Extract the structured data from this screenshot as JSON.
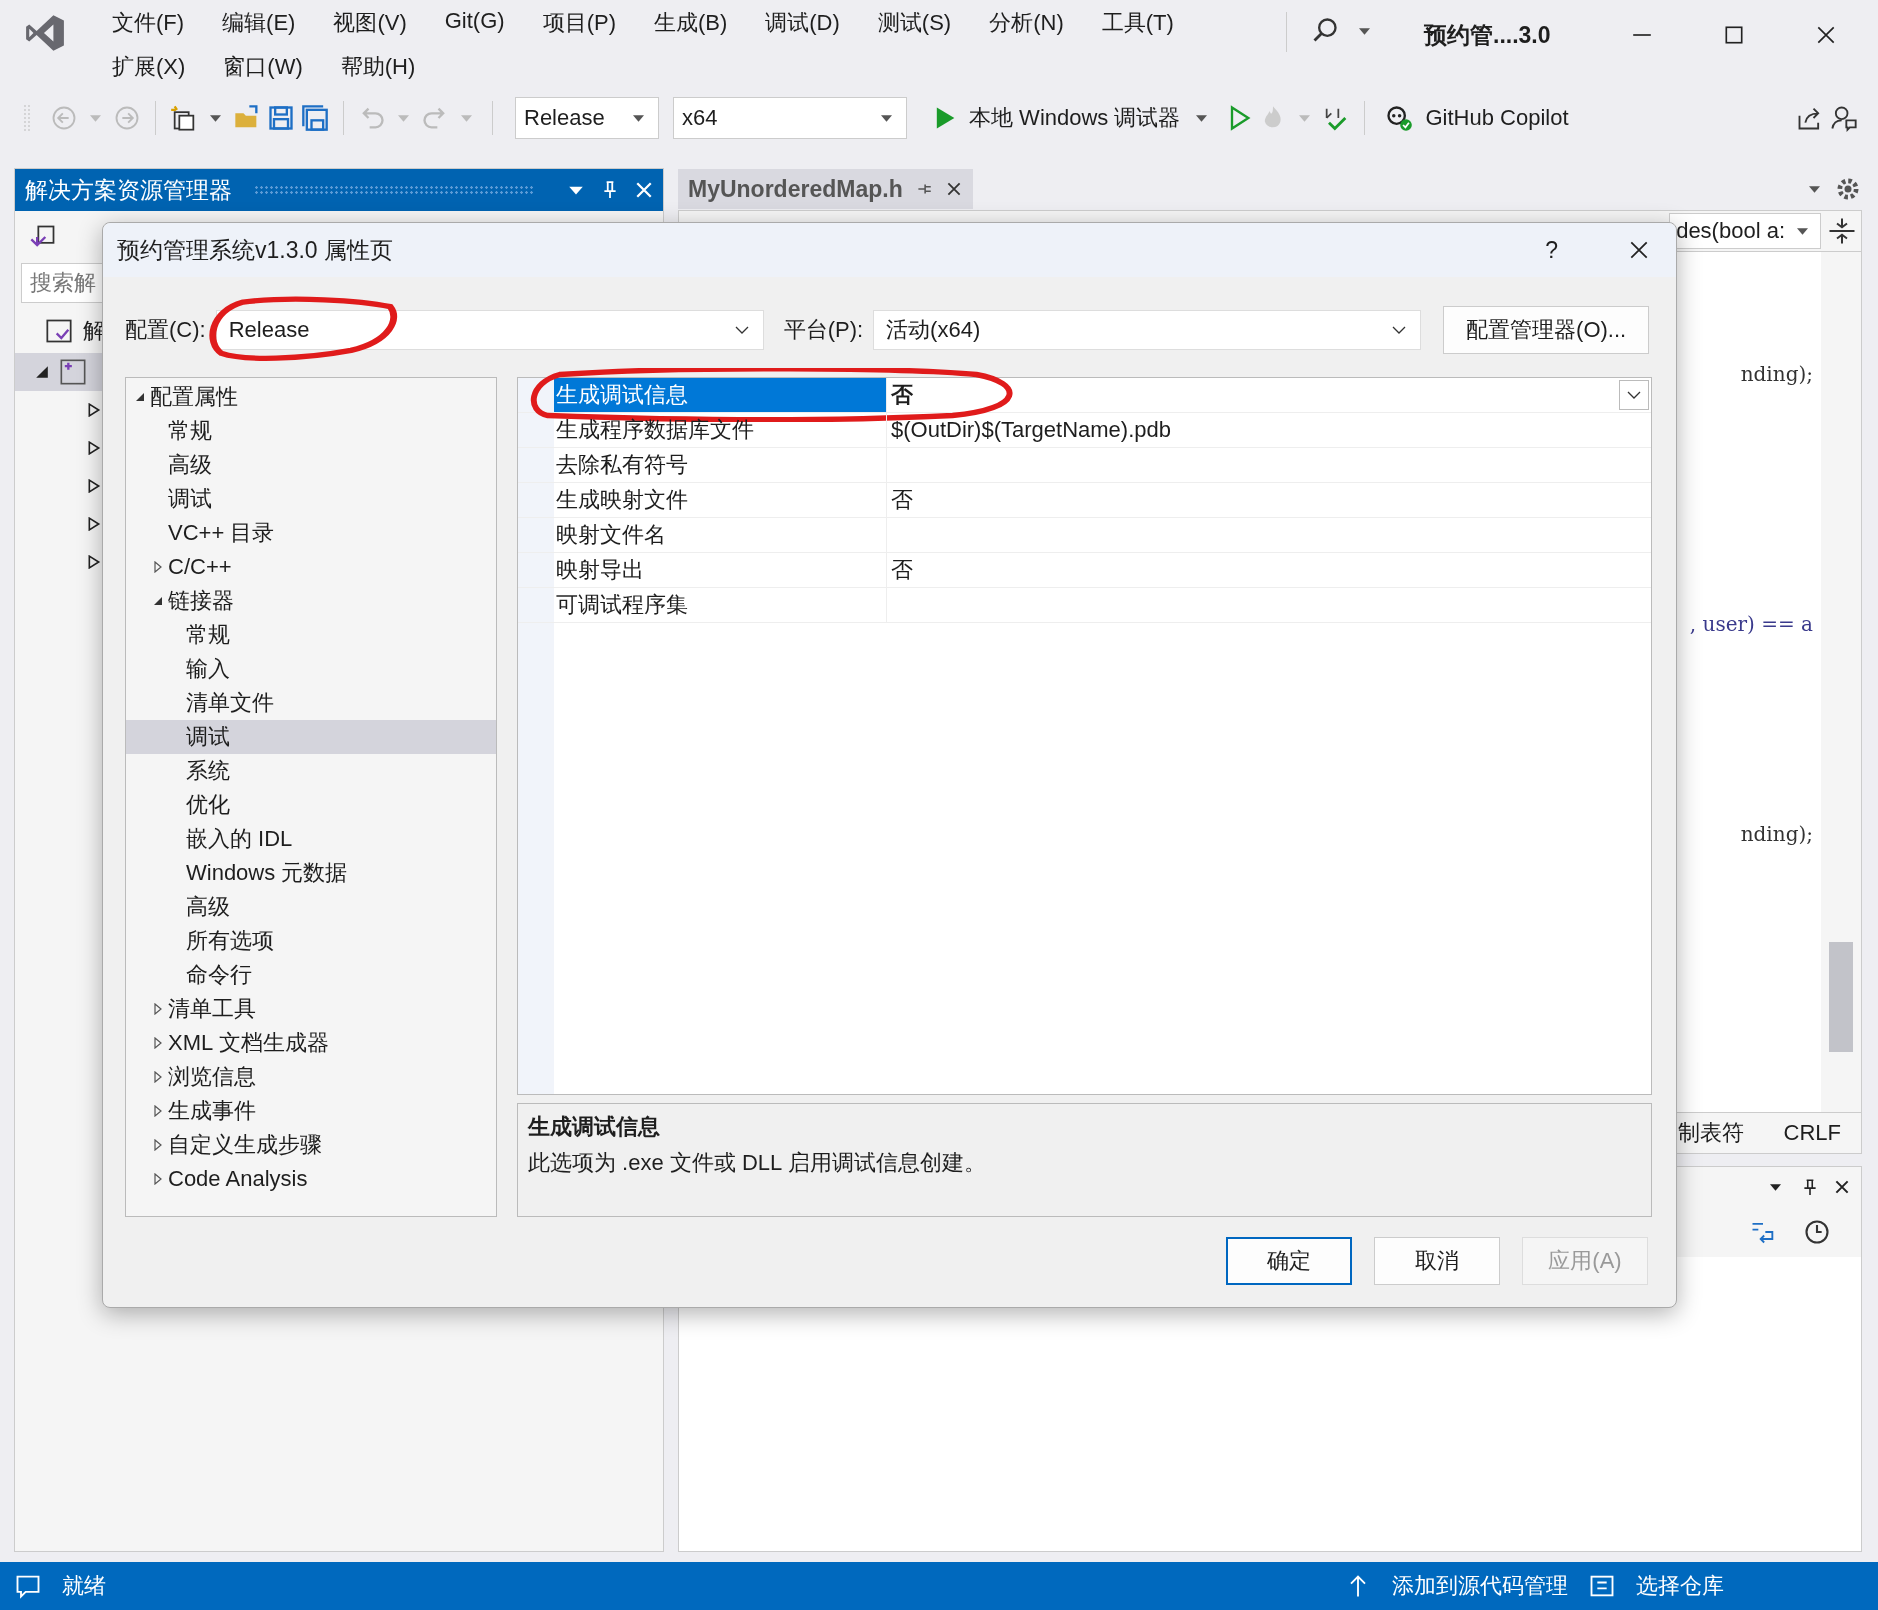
{
  "window": {
    "title": "预约管....3.0"
  },
  "menu_rows": [
    [
      "文件(F)",
      "编辑(E)",
      "视图(V)",
      "Git(G)",
      "项目(P)",
      "生成(B)",
      "调试(D)",
      "测试(S)",
      "分析(N)",
      "工具(T)"
    ],
    [
      "扩展(X)",
      "窗口(W)",
      "帮助(H)"
    ]
  ],
  "toolbar": {
    "configuration": "Release",
    "platform": "x64",
    "debugger": "本地 Windows 调试器",
    "copilot": "GitHub Copilot"
  },
  "solution_explorer": {
    "title": "解决方案资源管理器",
    "search_placeholder": "搜索解",
    "root": "解",
    "tree": [
      {
        "expanded": true,
        "selected": true
      },
      {
        "expanded": false,
        "selected": false
      },
      {
        "expanded": false,
        "selected": false
      },
      {
        "expanded": false,
        "selected": false
      },
      {
        "expanded": false,
        "selected": false
      },
      {
        "expanded": false,
        "selected": false
      }
    ]
  },
  "editor": {
    "tab": "MyUnorderedMap.h",
    "member_dropdown": "des(bool a:",
    "code_lines": [
      "nding);",
      ", user) == a",
      "nding);"
    ],
    "status": [
      "制表符",
      "CRLF"
    ]
  },
  "dialog": {
    "title": "预约管理系统v1.3.0 属性页",
    "help": "?",
    "config_label": "配置(C):",
    "config_value": "Release",
    "config_circled": true,
    "platform_label": "平台(P):",
    "platform_value": "活动(x64)",
    "config_manager": "配置管理器(O)...",
    "tree": [
      {
        "label": "配置属性",
        "expanded": true,
        "selected": false,
        "children": [
          {
            "label": "常规",
            "selected": false
          },
          {
            "label": "高级",
            "selected": false
          },
          {
            "label": "调试",
            "selected": false
          },
          {
            "label": "VC++ 目录",
            "selected": false
          },
          {
            "label": "C/C++",
            "expanded": false,
            "selected": false
          },
          {
            "label": "链接器",
            "expanded": true,
            "selected": false,
            "children": [
              {
                "label": "常规",
                "selected": false
              },
              {
                "label": "输入",
                "selected": false
              },
              {
                "label": "清单文件",
                "selected": false
              },
              {
                "label": "调试",
                "selected": true
              },
              {
                "label": "系统",
                "selected": false
              },
              {
                "label": "优化",
                "selected": false
              },
              {
                "label": "嵌入的 IDL",
                "selected": false
              },
              {
                "label": "Windows 元数据",
                "selected": false
              },
              {
                "label": "高级",
                "selected": false
              },
              {
                "label": "所有选项",
                "selected": false
              },
              {
                "label": "命令行",
                "selected": false
              }
            ]
          },
          {
            "label": "清单工具",
            "expanded": false,
            "selected": false
          },
          {
            "label": "XML 文档生成器",
            "expanded": false,
            "selected": false
          },
          {
            "label": "浏览信息",
            "expanded": false,
            "selected": false
          },
          {
            "label": "生成事件",
            "expanded": false,
            "selected": false
          },
          {
            "label": "自定义生成步骤",
            "expanded": false,
            "selected": false
          },
          {
            "label": "Code Analysis",
            "expanded": false,
            "selected": false
          }
        ]
      }
    ],
    "properties": [
      {
        "name": "生成调试信息",
        "value": "否",
        "selected": true,
        "circled": true
      },
      {
        "name": "生成程序数据库文件",
        "value": "$(OutDir)$(TargetName).pdb",
        "selected": false,
        "circled": false
      },
      {
        "name": "去除私有符号",
        "selected": false,
        "circled": false
      },
      {
        "name": "生成映射文件",
        "value": "否",
        "selected": false,
        "circled": false
      },
      {
        "name": "映射文件名",
        "selected": false,
        "circled": false
      },
      {
        "name": "映射导出",
        "value": "否",
        "selected": false,
        "circled": false
      },
      {
        "name": "可调试程序集",
        "selected": false,
        "circled": false
      }
    ],
    "description": {
      "title": "生成调试信息",
      "text": "此选项为 .exe 文件或 DLL 启用调试信息创建。"
    },
    "buttons": [
      {
        "label": "确定",
        "default": true,
        "disabled": false
      },
      {
        "label": "取消",
        "default": false,
        "disabled": false
      },
      {
        "label": "应用(A)",
        "default": false,
        "disabled": true
      }
    ]
  },
  "status_bar": {
    "state": "就绪",
    "source_control": "添加到源代码管理",
    "repository": "选择仓库"
  }
}
